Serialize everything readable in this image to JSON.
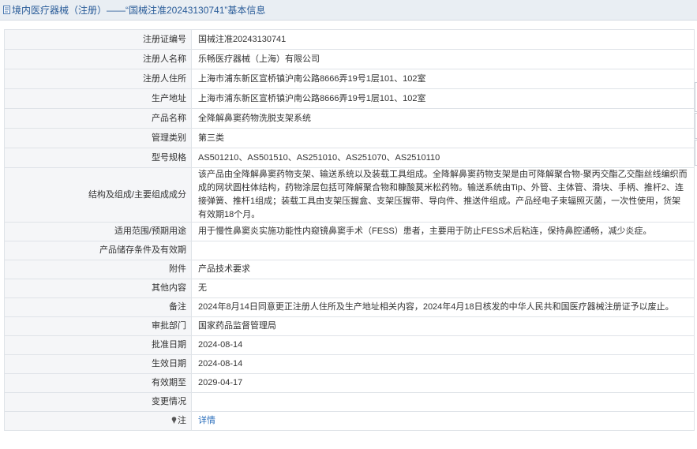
{
  "header": {
    "title": "境内医疗器械（注册）——“国械注准20243130741”基本信息"
  },
  "rows": [
    {
      "label": "注册证编号",
      "value": "国械注准20243130741"
    },
    {
      "label": "注册人名称",
      "value": "乐畅医疗器械（上海）有限公司"
    },
    {
      "label": "注册人住所",
      "value": "上海市浦东新区宣桥镇沪南公路8666弄19号1层101、102室"
    },
    {
      "label": "生产地址",
      "value": "上海市浦东新区宣桥镇沪南公路8666弄19号1层101、102室"
    },
    {
      "label": "产品名称",
      "value": "全降解鼻窦药物洗脱支架系统"
    },
    {
      "label": "管理类别",
      "value": "第三类"
    },
    {
      "label": "型号规格",
      "value": "AS501210、AS501510、AS251010、AS251070、AS2510110"
    },
    {
      "label": "结构及组成/主要组成成分",
      "value": "该产品由全降解鼻窦药物支架、输送系统以及装载工具组成。全降解鼻窦药物支架是由可降解聚合物-聚丙交酯乙交酯丝线编织而成的网状圆柱体结构，药物涂层包括可降解聚合物和糠酸莫米松药物。输送系统由Tip、外管、主体管、滑块、手柄、推杆2、连接弹簧、推杆1组成；装载工具由支架压握盒、支架压握带、导向件、推送件组成。产品经电子束辐照灭菌，一次性使用，货架有效期18个月。"
    },
    {
      "label": "适用范围/预期用途",
      "value": "用于慢性鼻窦炎实施功能性内窥镜鼻窦手术（FESS）患者，主要用于防止FESS术后粘连，保持鼻腔通畅，减少炎症。"
    },
    {
      "label": "产品储存条件及有效期",
      "value": ""
    },
    {
      "label": "附件",
      "value": "产品技术要求"
    },
    {
      "label": "其他内容",
      "value": "无"
    },
    {
      "label": "备注",
      "value": "2024年8月14日同意更正注册人住所及生产地址相关内容，2024年4月18日核发的中华人民共和国医疗器械注册证予以废止。"
    },
    {
      "label": "审批部门",
      "value": "国家药品监督管理局"
    },
    {
      "label": "批准日期",
      "value": "2024-08-14"
    },
    {
      "label": "生效日期",
      "value": "2024-08-14"
    },
    {
      "label": "有效期至",
      "value": "2029-04-17"
    },
    {
      "label": "变更情况",
      "value": ""
    }
  ],
  "note": {
    "label": "注",
    "link_text": "详情",
    "icon": "pin-icon"
  },
  "colors": {
    "link": "#2a6ebb",
    "title": "#2a5c99",
    "label_bg": "#f5f6f8",
    "border": "#dfe3e8"
  }
}
